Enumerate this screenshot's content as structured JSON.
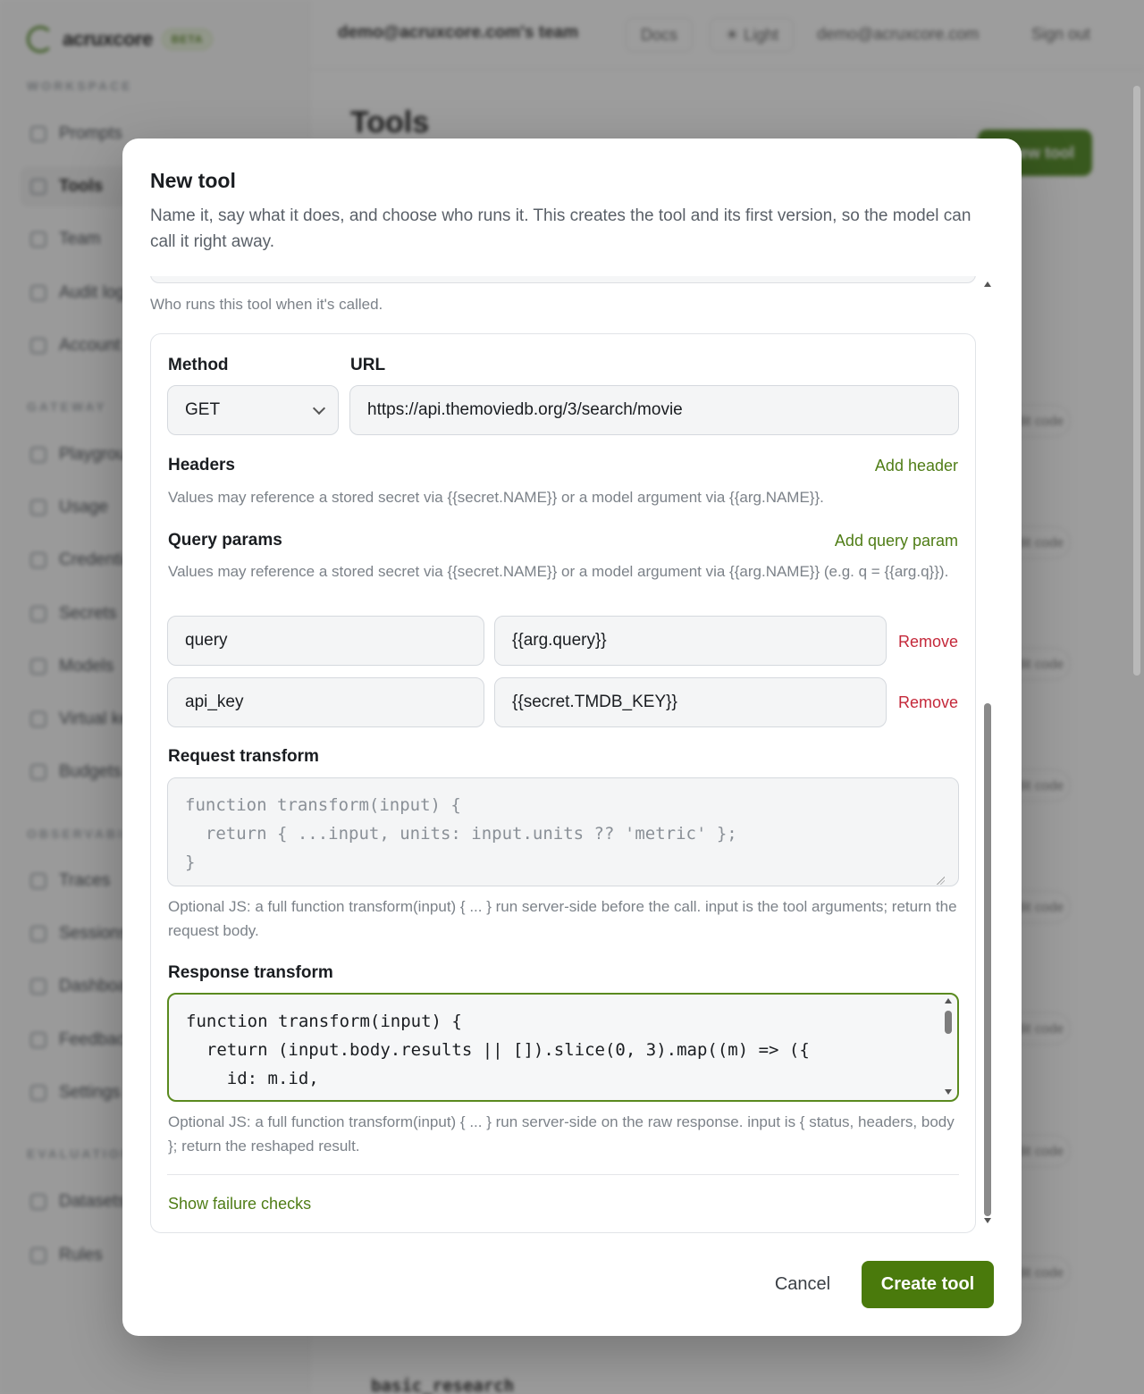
{
  "background": {
    "brand": {
      "name": "acruxcore",
      "badge": "BETA"
    },
    "sections": [
      "WORKSPACE",
      "GATEWAY",
      "OBSERVABILITY",
      "EVALUATION"
    ],
    "items": [
      "Prompts",
      "Tools",
      "Team",
      "Audit log",
      "Account",
      "Playground",
      "Usage",
      "Credentials",
      "Secrets",
      "Models",
      "Virtual keys",
      "Budgets",
      "Traces",
      "Sessions",
      "Dashboards",
      "Feedback",
      "Settings",
      "Datasets",
      "Rules"
    ],
    "team_name": "demo@acruxcore.com's team",
    "docs": "Docs",
    "theme": "Light",
    "user_email": "demo@acruxcore.com",
    "sign_out": "Sign out",
    "page_title": "Tools",
    "new_tool": "New tool",
    "row_button": "Edit code",
    "list_tool_name": "basic_research"
  },
  "modal": {
    "title": "New tool",
    "description": "Name it, say what it does, and choose who runs it. This creates the tool and its first version, so the model can call it right away.",
    "runner_hint": "Who runs this tool when it's called.",
    "method_label": "Method",
    "method_value": "GET",
    "url_label": "URL",
    "url_value": "https://api.themoviedb.org/3/search/movie",
    "headers_label": "Headers",
    "add_header": "Add header",
    "headers_hint": "Values may reference a stored secret via {{secret.NAME}} or a model argument via {{arg.NAME}}.",
    "query_label": "Query params",
    "add_query": "Add query param",
    "query_hint": "Values may reference a stored secret via {{secret.NAME}} or a model argument via {{arg.NAME}} (e.g. q = {{arg.q}}).",
    "query_params": [
      {
        "key": "query",
        "value": "{{arg.query}}",
        "remove": "Remove"
      },
      {
        "key": "api_key",
        "value": "{{secret.TMDB_KEY}}",
        "remove": "Remove"
      }
    ],
    "request_label": "Request transform",
    "request_placeholder": "function transform(input) {\n  return { ...input, units: input.units ?? 'metric' };\n}",
    "request_hint": "Optional JS: a full function transform(input) { ... } run server-side before the call. input is the tool arguments; return the request body.",
    "response_label": "Response transform",
    "response_value": "function transform(input) {\n  return (input.body.results || []).slice(0, 3).map((m) => ({\n    id: m.id,\n    title: m.title,",
    "response_hint": "Optional JS: a full function transform(input) { ... } run server-side on the raw response. input is { status, headers, body }; return the reshaped result.",
    "failure_checks": "Show failure checks",
    "cancel": "Cancel",
    "create": "Create tool"
  }
}
